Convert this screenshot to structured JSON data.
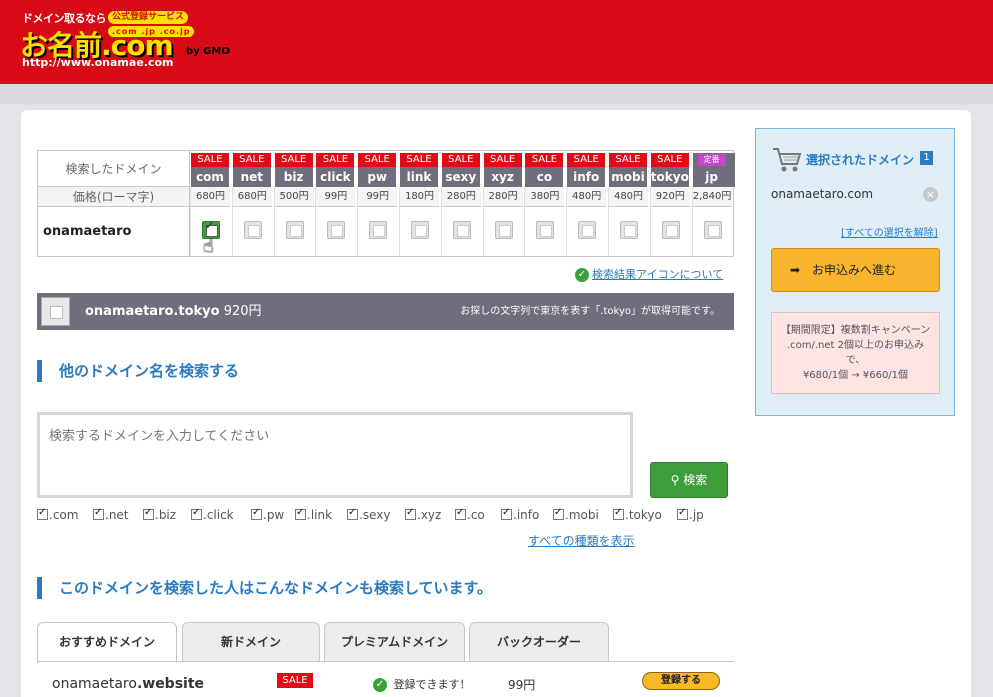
{
  "header": {
    "tagline": "ドメイン取るなら",
    "badge": "公式登録サービス",
    "tlds": ".com .jp .co.jp",
    "logo_text": "お名前.com",
    "by": "by GMO",
    "url": "http://www.onamae.com"
  },
  "results": {
    "label_searched": "検索したドメイン",
    "label_price": "価格(ローマ字)",
    "query": "onamaetaro",
    "tlds": [
      {
        "name": "com",
        "tag": "SALE",
        "price": "680円",
        "checked": true
      },
      {
        "name": "net",
        "tag": "SALE",
        "price": "680円",
        "checked": false
      },
      {
        "name": "biz",
        "tag": "SALE",
        "price": "500円",
        "checked": false
      },
      {
        "name": "click",
        "tag": "SALE",
        "price": "99円",
        "checked": false
      },
      {
        "name": "pw",
        "tag": "SALE",
        "price": "99円",
        "checked": false
      },
      {
        "name": "link",
        "tag": "SALE",
        "price": "180円",
        "checked": false
      },
      {
        "name": "sexy",
        "tag": "SALE",
        "price": "280円",
        "checked": false
      },
      {
        "name": "xyz",
        "tag": "SALE",
        "price": "280円",
        "checked": false
      },
      {
        "name": "co",
        "tag": "SALE",
        "price": "380円",
        "checked": false
      },
      {
        "name": "info",
        "tag": "SALE",
        "price": "480円",
        "checked": false
      },
      {
        "name": "mobi",
        "tag": "SALE",
        "price": "480円",
        "checked": false
      },
      {
        "name": "tokyo",
        "tag": "SALE",
        "price": "920円",
        "checked": false
      },
      {
        "name": "jp",
        "tag": "定番",
        "price": "2,840円",
        "checked": false
      }
    ],
    "icon_link": "検索結果アイコンについて"
  },
  "tokyo_bar": {
    "domain": "onamaetaro.tokyo",
    "price": "920円",
    "note": "お探しの文字列で東京を表す「.tokyo」が取得可能です。"
  },
  "search": {
    "title": "他のドメイン名を検索する",
    "placeholder": "検索するドメインを入力してください",
    "button": "検索",
    "options": [
      ".com",
      ".net",
      ".biz",
      ".click",
      ".pw",
      ".link",
      ".sexy",
      ".xyz",
      ".co",
      ".info",
      ".mobi",
      ".tokyo",
      ".jp"
    ],
    "all_types_link": "すべての種類を表示"
  },
  "recommend": {
    "title": "このドメインを検索した人はこんなドメインも検索しています。",
    "tabs": [
      "おすすめドメイン",
      "新ドメイン",
      "プレミアムドメイン",
      "バックオーダー"
    ],
    "row": {
      "domain_prefix": "onamaetaro",
      "domain_tld": ".website",
      "tag": "SALE",
      "status": "登録できます！",
      "price": "99円",
      "button": "登録する"
    }
  },
  "sidebar": {
    "title": "選択されたドメイン",
    "count": "1",
    "selected_domain": "onamaetaro.com",
    "clear_all": "[すべての選択を解除]",
    "apply_button": "お申込みへ進む",
    "campaign": [
      "【期間限定】複数割キャンペーン",
      ".com/.net 2個以上のお申込み",
      "で、",
      "¥680/1個 → ¥660/1個"
    ]
  },
  "colors": {
    "brand_red": "#d80a15",
    "accent_blue": "#2a7bc0",
    "sale_red": "#e10b18",
    "search_green": "#3d9e3a",
    "apply_orange": "#f7b42c"
  }
}
